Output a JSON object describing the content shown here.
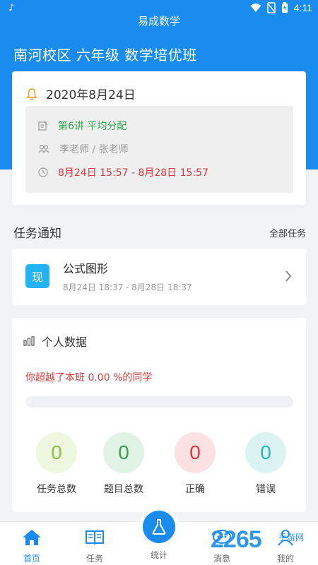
{
  "status_bar": {
    "time": "4:11"
  },
  "header": {
    "app_title": "易成数学",
    "class_title": "南河校区 六年级 数学培优班"
  },
  "course": {
    "date": "2020年8月24日",
    "lesson": "第6讲 平均分配",
    "teachers": "李老师 / 张老师",
    "time_range": "8月24日 15:57 - 8月28日 15:57"
  },
  "tasks": {
    "section_title": "任务通知",
    "all_link": "全部任务",
    "items": [
      {
        "badge": "现",
        "title": "公式图形",
        "time": "8月24日 18:37 - 8月28日 18:37"
      }
    ]
  },
  "personal": {
    "title": "个人数据",
    "exceed_text": "你超越了本班 0.00 %的同学",
    "progress_fraction": 0,
    "progress_label": "0",
    "stats": [
      {
        "value": "0",
        "label": "任务总数",
        "bg": "#eef7df",
        "fg": "#8dc13f"
      },
      {
        "value": "0",
        "label": "题目总数",
        "bg": "#dff2e3",
        "fg": "#33a24d"
      },
      {
        "value": "0",
        "label": "正确",
        "bg": "#fbe1e1",
        "fg": "#d9393a"
      },
      {
        "value": "0",
        "label": "错误",
        "bg": "#dbf3f3",
        "fg": "#2cb7b4"
      }
    ]
  },
  "nav": {
    "home": "首页",
    "tasks": "任务",
    "stats": "统计",
    "messages": "消息",
    "mine": "我的"
  },
  "watermark": {
    "logo": "2265",
    "suffix": "手游网"
  },
  "colors": {
    "primary": "#1a8cf0",
    "green": "#2aa44a",
    "red": "#d9393a",
    "badge": "#23b3f2"
  }
}
